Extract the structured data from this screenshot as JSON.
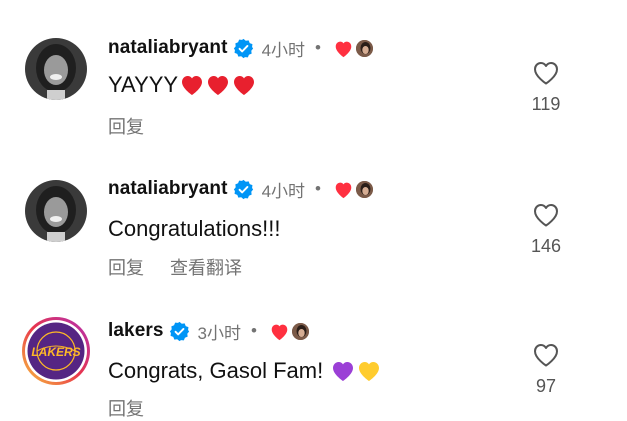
{
  "colors": {
    "verified": "#0095f6",
    "heart": "#ff3040",
    "secondary_text": "#737373",
    "lakers_purple": "#552583",
    "lakers_gold": "#fdb927"
  },
  "comments": [
    {
      "username": "nataliabryant",
      "verified": true,
      "time": "4小时",
      "dot": "•",
      "creator_liked": true,
      "text": "YAYYY",
      "emojis": [
        "red-heart",
        "red-heart",
        "red-heart"
      ],
      "actions": [
        "回复"
      ],
      "like_count": "119",
      "avatar": "natalia-avatar"
    },
    {
      "username": "nataliabryant",
      "verified": true,
      "time": "4小时",
      "dot": "•",
      "creator_liked": true,
      "text": "Congratulations!!!",
      "emojis": [],
      "actions": [
        "回复",
        "查看翻译"
      ],
      "like_count": "146",
      "avatar": "natalia-avatar"
    },
    {
      "username": "lakers",
      "verified": true,
      "time": "3小时",
      "dot": "•",
      "creator_liked": true,
      "text": "Congrats, Gasol Fam!",
      "emojis": [
        "purple-heart",
        "yellow-heart"
      ],
      "actions": [
        "回复"
      ],
      "like_count": "97",
      "avatar": "lakers-logo"
    }
  ]
}
